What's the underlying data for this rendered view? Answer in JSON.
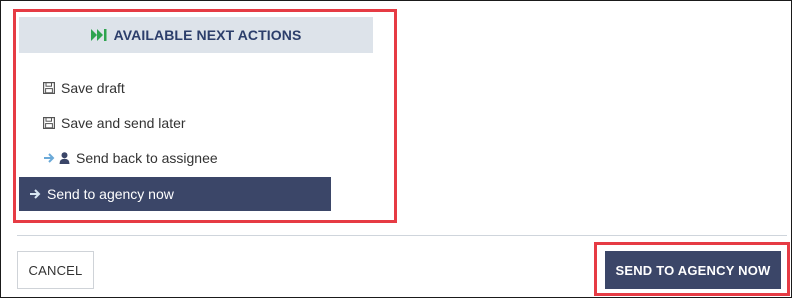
{
  "panel": {
    "header": {
      "icon": "fast-forward-icon",
      "label": "AVAILABLE NEXT ACTIONS"
    },
    "actions": [
      {
        "icons": [
          "save-icon"
        ],
        "label": "Save draft",
        "active": false
      },
      {
        "icons": [
          "save-icon"
        ],
        "label": "Save and send later",
        "active": false
      },
      {
        "icons": [
          "arrow-right-icon",
          "user-icon"
        ],
        "label": "Send back to assignee",
        "active": false
      },
      {
        "icons": [
          "arrow-right-icon"
        ],
        "label": "Send to agency now",
        "active": true
      }
    ]
  },
  "footer": {
    "cancel_label": "CANCEL",
    "submit_label": "SEND TO AGENCY NOW"
  },
  "colors": {
    "highlight": "#e63b44",
    "primary": "#3b4668",
    "header_bg": "#dde3ea",
    "header_text": "#2c3e6b",
    "accent_icon": "#2ea44f",
    "arrow_icon": "#6aa9d8"
  }
}
